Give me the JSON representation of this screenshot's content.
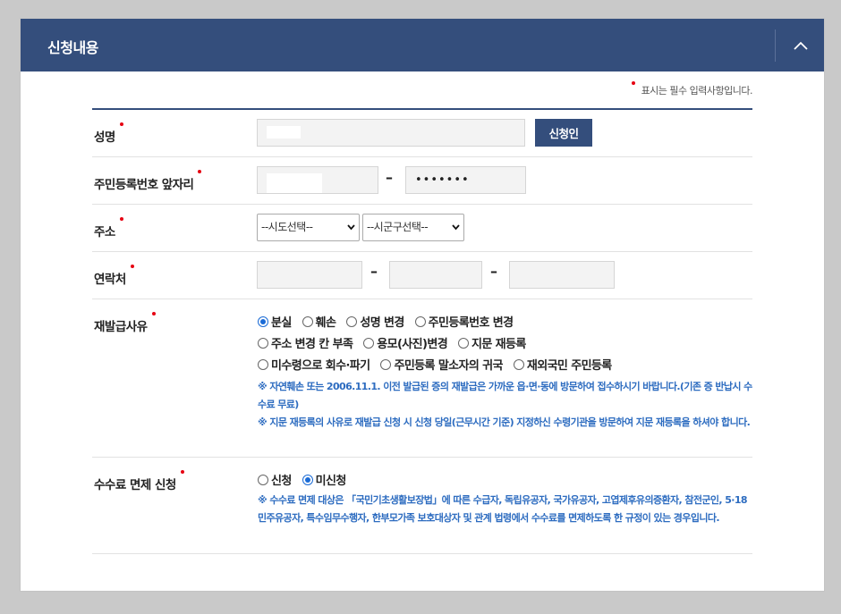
{
  "header": {
    "title": "신청내용",
    "collapse_icon": "chevron-up-icon"
  },
  "required_note": "표시는 필수 입력사항입니다.",
  "fields": {
    "name": {
      "label": "성명",
      "button": "신청인"
    },
    "resident_number": {
      "label": "주민등록번호 앞자리",
      "separator": "–",
      "back_value": "•••••••"
    },
    "address": {
      "label": "주소",
      "sido_selected": "--시도선택--",
      "sigungu_selected": "--시군구선택--"
    },
    "contact": {
      "label": "연락처",
      "separator": "–"
    },
    "reason": {
      "label": "재발급사유",
      "options": [
        {
          "label": "분실",
          "checked": true
        },
        {
          "label": "훼손",
          "checked": false
        },
        {
          "label": "성명 변경",
          "checked": false
        },
        {
          "label": "주민등록번호 변경",
          "checked": false
        },
        {
          "label": "주소 변경 칸 부족",
          "checked": false
        },
        {
          "label": "용모(사진)변경",
          "checked": false
        },
        {
          "label": "지문 재등록",
          "checked": false
        },
        {
          "label": "미수령으로 회수·파기",
          "checked": false
        },
        {
          "label": "주민등록 말소자의 귀국",
          "checked": false
        },
        {
          "label": "재외국민 주민등록",
          "checked": false
        }
      ],
      "notes": [
        "※ 자연훼손 또는 2006.11.1. 이전 발급된 증의 재발급은 가까운 읍·면·동에 방문하여 접수하시기 바랍니다.(기존 증 반납시 수수료 무료)",
        "※ 지문 재등록의 사유로 재발급 신청 시 신청 당일(근무시간 기준) 지정하신 수령기관을 방문하여 지문 재등록을 하셔야 합니다."
      ]
    },
    "fee_exemption": {
      "label": "수수료 면제 신청",
      "options": [
        {
          "label": "신청",
          "checked": false
        },
        {
          "label": "미신청",
          "checked": true
        }
      ],
      "note": "※ 수수료 면제 대상은 「국민기초생활보장법」에 따른 수급자, 독립유공자, 국가유공자, 고엽제후유의증환자, 참전군인, 5·18민주유공자, 특수임무수행자, 한부모가족 보호대상자 및 관계 법령에서 수수료를 면제하도록 한 규정이 있는 경우입니다."
    }
  },
  "colors": {
    "header_bg": "#344e7c",
    "required": "#e60012",
    "note_text": "#2d6cc0",
    "radio_checked": "#1a6bd6"
  }
}
